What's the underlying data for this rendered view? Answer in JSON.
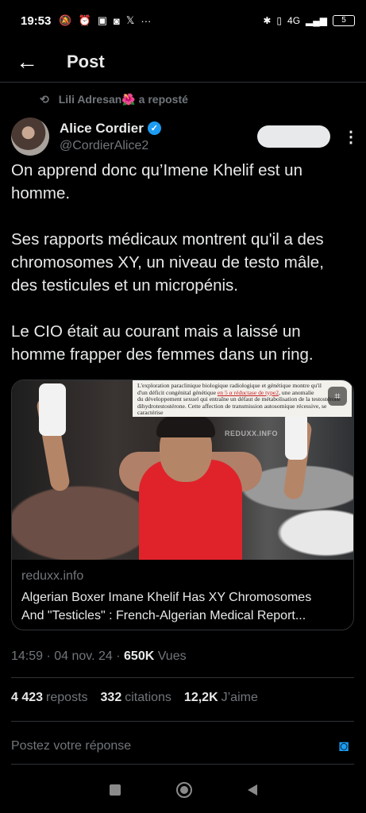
{
  "status_bar": {
    "time": "19:53",
    "left_icons": [
      "mute-icon",
      "alarm-icon",
      "clipboard-icon",
      "app-icon",
      "x-logo-icon",
      "more-dots-icon"
    ],
    "right_icons": [
      "bluetooth-icon",
      "vibrate-icon",
      "signal-icon"
    ],
    "network": "4G",
    "battery": "5"
  },
  "header": {
    "title": "Post"
  },
  "repost": {
    "text": "Lili Adresan🌺 a reposté"
  },
  "author": {
    "display_name": "Alice Cordier",
    "handle": "@CordierAlice2",
    "verified": true
  },
  "tweet": {
    "paragraphs": [
      "On apprend donc qu’Imene Khelif est un homme.",
      "Ses rapports médicaux montrent qu'il a des chromosomes XY, un niveau de testo mâle, des testicules et un micropénis.",
      "Le CIO était au courant mais a laissé un homme frapper des femmes dans un ring."
    ]
  },
  "card": {
    "document_lines": [
      "L'exploration paraclinique biologique radiologique et génétique montre qu'il",
      "d'un déficit congénital génétique",
      "en 5 α réductase de type2",
      ", une anomalie",
      "du développement sexuel qui entraîne un défaut de métabolisation de la testostérone",
      "dihydrotestostérone. Cette affection de transmission autosomique récessive, se caractérise"
    ],
    "watermark": "REDUXX.INFO",
    "domain": "reduxx.info",
    "title_line1": "Algerian Boxer Imane Khelif Has XY Chromosomes",
    "title_line2": "And \"Testicles\" : French-Algerian Medical Report..."
  },
  "meta": {
    "time": "14:59 · 04 nov. 24 · ",
    "views_count": "650K",
    "views_label": " Vues"
  },
  "stats": {
    "reposts_count": "4 423",
    "reposts_label": "reposts",
    "quotes_count": "332",
    "quotes_label": "citations",
    "likes_count": "12,2K",
    "likes_label": "J’aime"
  },
  "reply": {
    "placeholder": "Postez votre réponse"
  },
  "colors": {
    "background": "#000000",
    "text": "#e7e9ea",
    "muted": "#71767b",
    "accent": "#1d9bf0",
    "divider": "#2f3336"
  }
}
